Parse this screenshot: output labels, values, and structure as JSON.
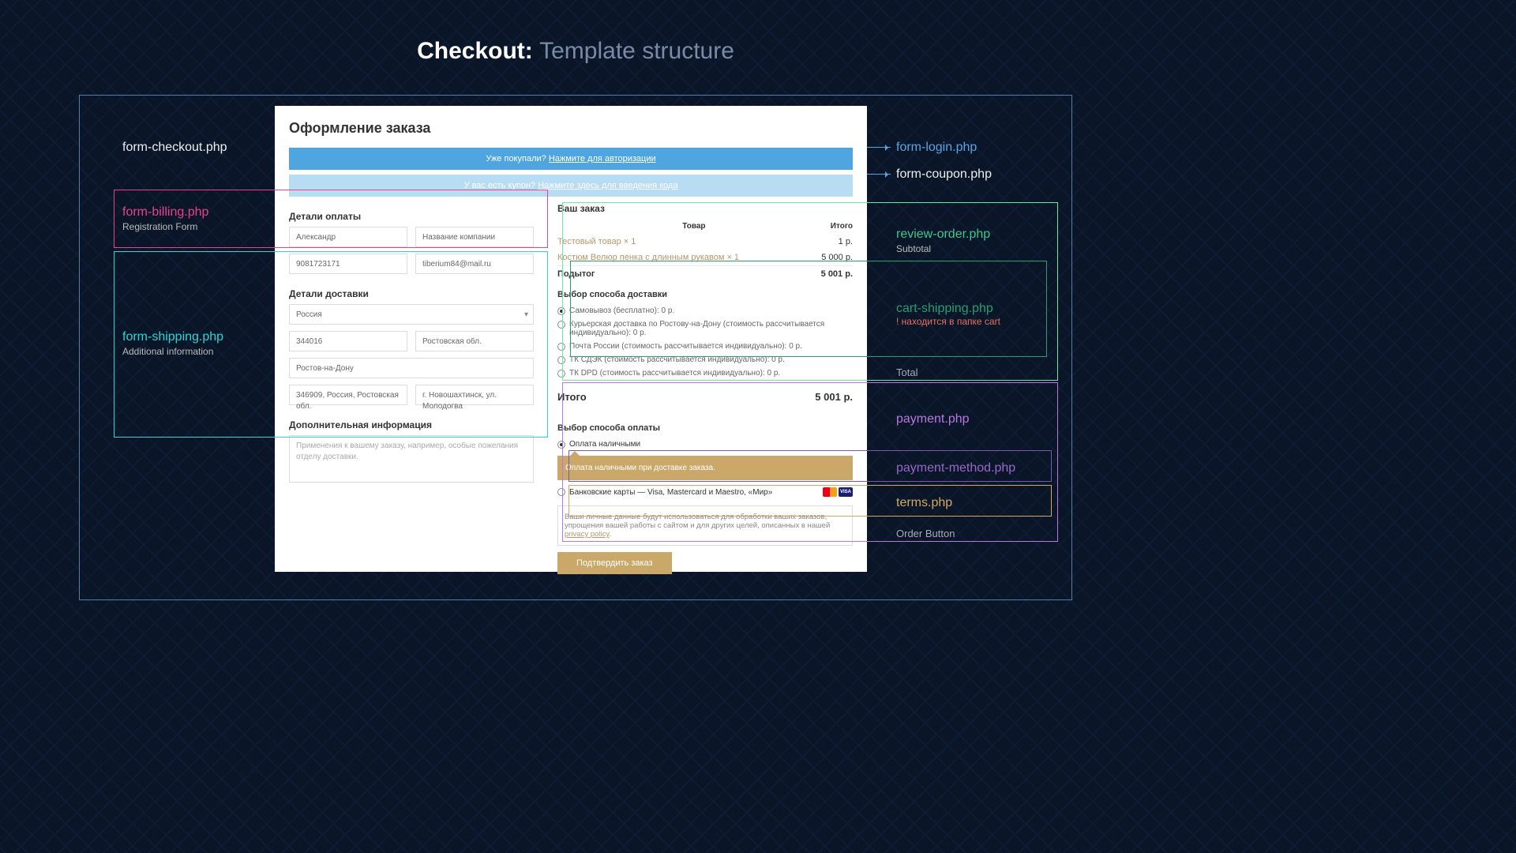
{
  "title": {
    "prefix": "Checkout:",
    "suffix": "Template structure"
  },
  "left_labels": {
    "checkout": "form-checkout.php",
    "billing": "form-billing.php",
    "billing_sub": "Registration Form",
    "shipping": "form-shipping.php",
    "shipping_sub": "Additional information"
  },
  "right_labels": {
    "login": "form-login.php",
    "coupon": "form-coupon.php",
    "review": "review-order.php",
    "review_sub": "Subtotal",
    "cart_ship": "cart-shipping.php",
    "cart_ship_note": "! находится в папке cart",
    "total": "Total",
    "payment": "payment.php",
    "paymethod": "payment-method.php",
    "terms": "terms.php",
    "order_btn": "Order Button"
  },
  "checkout": {
    "h1": "Оформление заказа",
    "login_banner": {
      "text": "Уже покупали? ",
      "link": "Нажмите для авторизации"
    },
    "coupon_banner": {
      "text": "У вас есть купон? ",
      "link": "Нажмите здесь для введения кода"
    },
    "billing": {
      "h": "Детали оплаты",
      "name": "Александр",
      "company": "Название компании",
      "phone": "9081723171",
      "email": "tiberium84@mail.ru"
    },
    "shipping": {
      "h": "Детали доставки",
      "country": "Россия",
      "zip": "344016",
      "region": "Ростовская обл.",
      "city": "Ростов-на-Дону",
      "addr1": "346909, Россия, Ростовская обл.",
      "addr2": "г. Новошахтинск, ул. Молодогва",
      "extra_h": "Дополнительная информация",
      "extra_ph": "Применения к вашему заказу, например, особые пожелания отделу доставки."
    },
    "order": {
      "h": "Ваш заказ",
      "cols": {
        "product": "Товар",
        "total": "Итого"
      },
      "items": [
        {
          "name": "Тестовый товар × 1",
          "price": "1 р."
        },
        {
          "name": "Костюм Велюр пенка с длинным рукавом × 1",
          "price": "5 000 р."
        }
      ],
      "subtotal_label": "Подытог",
      "subtotal_value": "5 001 р.",
      "ship_h": "Выбор способа доставки",
      "ship_opts": [
        "Самовывоз (бесплатно): 0 р.",
        "Курьерская доставка по Ростову-на-Дону (стоимость рассчитывается индивидуально): 0 р.",
        "Почта России (стоимость рассчитывается индивидуально): 0 р.",
        "ТК СДЭК (стоимость рассчитывается индивидуально): 0 р.",
        "ТК DPD (стоимость рассчитывается индивидуально): 0 р."
      ],
      "total_label": "Итого",
      "total_value": "5 001 р."
    },
    "payment": {
      "h": "Выбор способа оплаты",
      "opt_cash": "Оплата наличными",
      "note": "Оплата наличными при доставке заказа.",
      "opt_card": "Банковские карты — Visa, Mastercard и Maestro, «Мир»",
      "card_visa": "VISA"
    },
    "terms": {
      "text": "Ваши личные данные будут использоваться для обработки ваших заказов, упрощения вашей работы с сайтом и для других целей, описанных в нашей ",
      "link": "privacy policy"
    },
    "confirm": "Подтвердить заказ"
  }
}
